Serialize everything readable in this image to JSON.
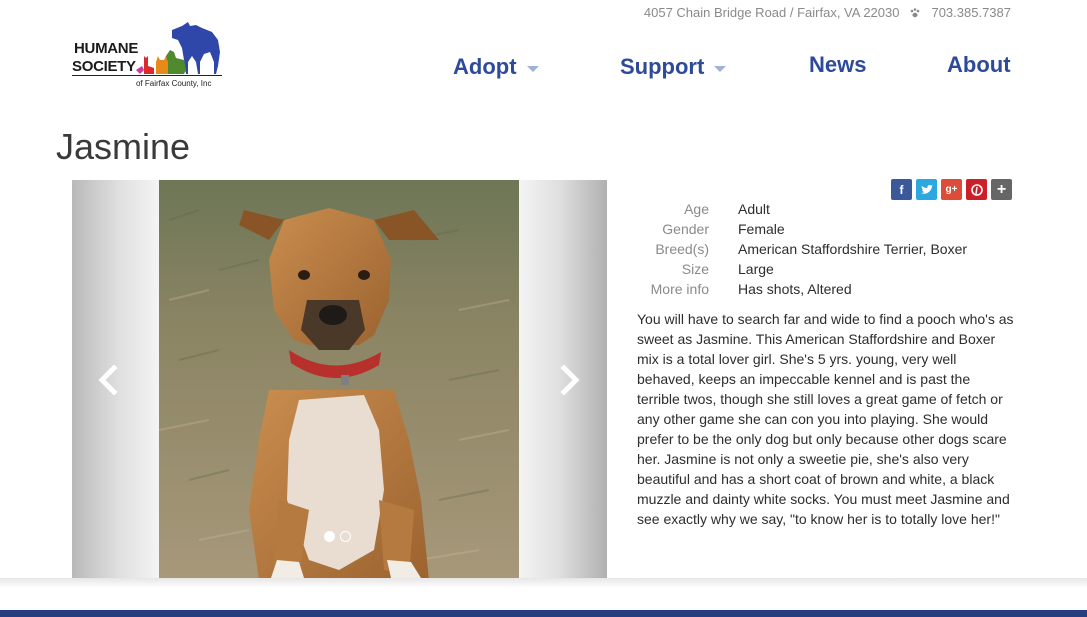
{
  "topbar": {
    "address": "4057 Chain Bridge Road / Fairfax, VA 22030",
    "phone": "703.385.7387"
  },
  "logo": {
    "line1": "HUMANE",
    "line2": "SOCIETY",
    "line3": "of Fairfax County, Inc"
  },
  "nav": {
    "items": [
      {
        "label": "Adopt"
      },
      {
        "label": "Support"
      },
      {
        "label": "News"
      },
      {
        "label": "About"
      }
    ]
  },
  "page": {
    "title": "Jasmine"
  },
  "carousel": {
    "slide_count": 2,
    "active_index": 0
  },
  "share": {
    "buttons": [
      {
        "icon": "facebook-icon",
        "glyph": "f",
        "color": "#3b5998"
      },
      {
        "icon": "twitter-icon",
        "glyph": "t",
        "color": "#2ca8e1"
      },
      {
        "icon": "google-plus-icon",
        "glyph": "g+",
        "color": "#dd4b39"
      },
      {
        "icon": "pinterest-icon",
        "glyph": "p",
        "color": "#cb2027"
      },
      {
        "icon": "more-share-icon",
        "glyph": "+",
        "color": "#666666"
      }
    ]
  },
  "details": {
    "rows": [
      {
        "label": "Age",
        "value": "Adult"
      },
      {
        "label": "Gender",
        "value": "Female"
      },
      {
        "label": "Breed(s)",
        "value": "American Staffordshire Terrier, Boxer"
      },
      {
        "label": "Size",
        "value": "Large"
      },
      {
        "label": "More info",
        "value": "Has shots, Altered"
      }
    ]
  },
  "description": "You will have to search far and wide to find a pooch who's as sweet as Jasmine. This American Staffordshire and Boxer mix is a total lover girl. She's 5 yrs. young, very well behaved, keeps an impeccable kennel and is past the terrible twos, though she still loves a great game of fetch or any other game she can con you into playing. She would prefer to be the only dog but only because other dogs scare her. Jasmine is not only a sweetie pie, she's also very beautiful and has a short coat of brown and white, a black muzzle and dainty white socks. You must meet Jasmine and see exactly why we say, \"to know her is to totally love her!\"",
  "colors": {
    "nav": "#2e4a9a",
    "footer": "#263d80"
  }
}
